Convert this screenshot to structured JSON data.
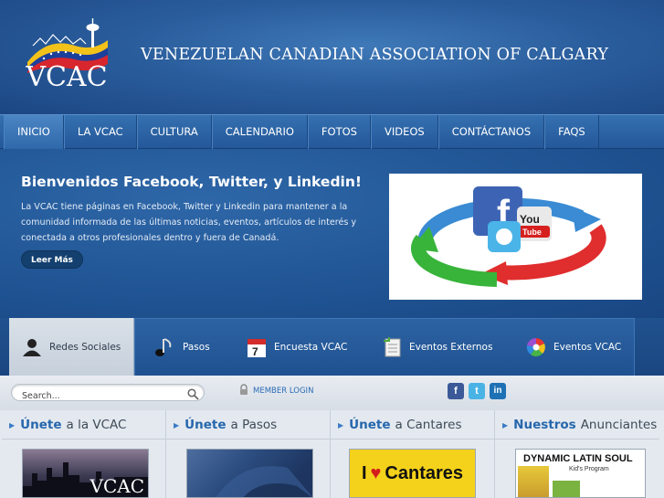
{
  "header": {
    "logo_text": "VCAC",
    "site_title": "VENEZUELAN CANADIAN ASSOCIATION OF CALGARY"
  },
  "nav": {
    "items": [
      {
        "label": "INICIO",
        "active": true
      },
      {
        "label": "LA VCAC"
      },
      {
        "label": "CULTURA"
      },
      {
        "label": "CALENDARIO"
      },
      {
        "label": "FOTOS"
      },
      {
        "label": "VIDEOS"
      },
      {
        "label": "CONTÁCTANOS"
      },
      {
        "label": "FAQS"
      }
    ]
  },
  "hero": {
    "title": "Bienvenidos Facebook, Twitter, y Linkedin!",
    "body": "La VCAC tiene páginas en Facebook, Twitter y Linkedin para mantener a la comunidad informada de las últimas noticias, eventos, artículos de interés y conectada a otros profesionales dentro y fuera de Canadá.",
    "button": "Leer Más",
    "image_icons": [
      "facebook-icon",
      "twitter-icon",
      "youtube-icon"
    ]
  },
  "tabs": {
    "items": [
      {
        "label": "Redes Sociales",
        "icon": "person-icon",
        "active": true
      },
      {
        "label": "Pasos",
        "icon": "music-note-icon"
      },
      {
        "label": "Encuesta VCAC",
        "icon": "calendar-icon"
      },
      {
        "label": "Eventos Externos",
        "icon": "document-icon"
      },
      {
        "label": "Eventos VCAC",
        "icon": "color-wheel-icon"
      }
    ]
  },
  "toolbar": {
    "search_placeholder": "Search...",
    "member_login": "MEMBER LOGIN",
    "social": [
      {
        "name": "facebook",
        "glyph": "f",
        "color": "#3b5998"
      },
      {
        "name": "twitter",
        "glyph": "t",
        "color": "#4ab3e6"
      },
      {
        "name": "linkedin",
        "glyph": "in",
        "color": "#1e71b5"
      }
    ]
  },
  "columns": [
    {
      "strong": "Únete",
      "rest": "a la VCAC",
      "thumb_text": "VCAC"
    },
    {
      "strong": "Únete",
      "rest": "a Pasos",
      "thumb_text": ""
    },
    {
      "strong": "Únete",
      "rest": "a Cantares",
      "thumb_text_left": "I",
      "thumb_text_right": "Cantares"
    },
    {
      "strong": "Nuestros",
      "rest": "Anunciantes",
      "thumb_title": "DYNAMIC LATIN SOUL",
      "thumb_sub": "Kid's Program"
    }
  ],
  "colors": {
    "nav_bg": "#2a5d9c",
    "link_blue": "#2667ad",
    "cantares_yellow": "#f4d21b",
    "heart_red": "#d41c1c"
  }
}
